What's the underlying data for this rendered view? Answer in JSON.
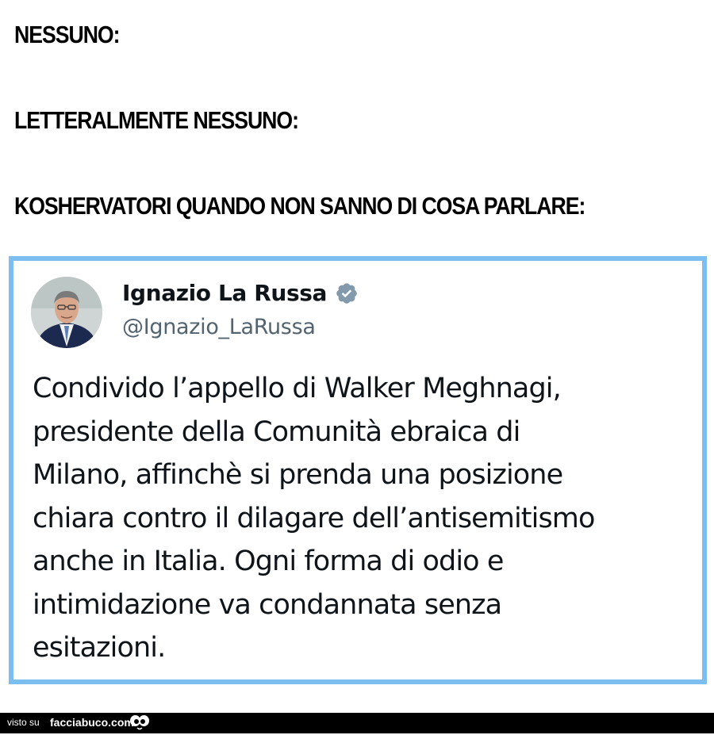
{
  "meme": {
    "lines": [
      "NESSUNO:",
      "LETTERALMENTE NESSUNO:",
      "KOSHERVATORI QUANDO NON SANNO DI COSA PARLARE:"
    ]
  },
  "tweet": {
    "display_name": "Ignazio La Russa",
    "handle": "@Ignazio_LaRussa",
    "verified_icon": "verified-badge-icon",
    "text": "Condivido l’appello di Walker Meghnagi,\npresidente della Comunità ebraica di\nMilano, affinchè si prenda una posizione\nchiara contro il dilagare dell’antisemitismo\nanche in Italia. Ogni forma di odio e\nintimidazione va condannata senza\nesitazioni."
  },
  "footer": {
    "prefix": "visto su",
    "site": "facciabuco.com",
    "logo_icon": "eyes-logo-icon"
  },
  "colors": {
    "frame_border": "#7dbef0",
    "verified_badge": "#829aab",
    "handle_text": "#536471",
    "footer_background": "#000000"
  }
}
